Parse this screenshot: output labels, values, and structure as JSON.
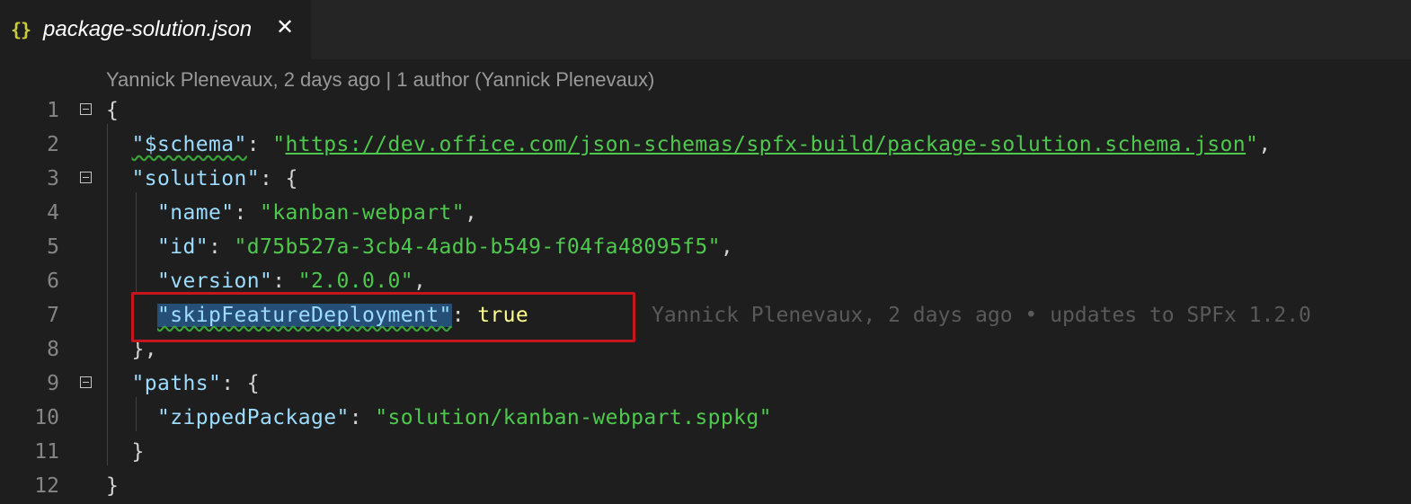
{
  "tab": {
    "icon": "{}",
    "icon_name": "json-braces-icon",
    "filename": "package-solution.json",
    "close_glyph": "✕"
  },
  "codelens": "Yannick Plenevaux, 2 days ago | 1 author (Yannick Plenevaux)",
  "editor": {
    "lines": [
      {
        "n": "1"
      },
      {
        "n": "2"
      },
      {
        "n": "3"
      },
      {
        "n": "4"
      },
      {
        "n": "5"
      },
      {
        "n": "6"
      },
      {
        "n": "7"
      },
      {
        "n": "8"
      },
      {
        "n": "9"
      },
      {
        "n": "10"
      },
      {
        "n": "11"
      },
      {
        "n": "12"
      }
    ],
    "schema_key": "\"$schema\"",
    "schema_value": "https://dev.office.com/json-schemas/spfx-build/package-solution.schema.json",
    "solution_key": "\"solution\"",
    "name_key": "\"name\"",
    "name_value": "\"kanban-webpart\"",
    "id_key": "\"id\"",
    "id_value": "\"d75b527a-3cb4-4adb-b549-f04fa48095f5\"",
    "version_key": "\"version\"",
    "version_value": "\"2.0.0.0\"",
    "skip_key": "\"skipFeatureDeployment\"",
    "skip_value": "true",
    "paths_key": "\"paths\"",
    "zipped_key": "\"zippedPackage\"",
    "zipped_value": "\"solution/kanban-webpart.sppkg\"",
    "blame_line7": "Yannick Plenevaux, 2 days ago • updates to SPFx 1.2.0"
  },
  "colors": {
    "background": "#1e1e1e",
    "key": "#9cdcfe",
    "string": "#4ec94e",
    "boolean": "#ffff8f",
    "highlight_box": "#c4161c",
    "selection": "#264f78"
  }
}
